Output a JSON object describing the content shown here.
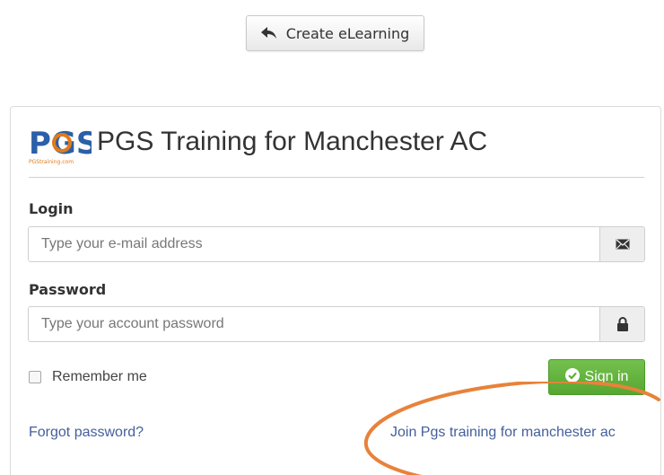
{
  "top_button": {
    "label": "Create eLearning",
    "icon": "reply-arrow-icon"
  },
  "header": {
    "logo_text": "PGS",
    "logo_subtext": "PGStraining.com",
    "title": "PGS Training for Manchester AC"
  },
  "login": {
    "label": "Login",
    "placeholder": "Type your e-mail address",
    "value": "",
    "icon": "envelope-icon"
  },
  "password": {
    "label": "Password",
    "placeholder": "Type your account password",
    "value": "",
    "icon": "lock-icon"
  },
  "remember": {
    "label": "Remember me",
    "checked": false
  },
  "signin": {
    "label": "Sign in",
    "icon": "check-circle-icon"
  },
  "links": {
    "forgot": "Forgot password?",
    "join": "Join Pgs training for manchester ac"
  },
  "colors": {
    "signin_green": "#5cb335",
    "link_blue": "#44609b",
    "annotation_orange": "#e8823a",
    "logo_blue": "#2b5fa8",
    "logo_orange": "#e07b1a"
  }
}
